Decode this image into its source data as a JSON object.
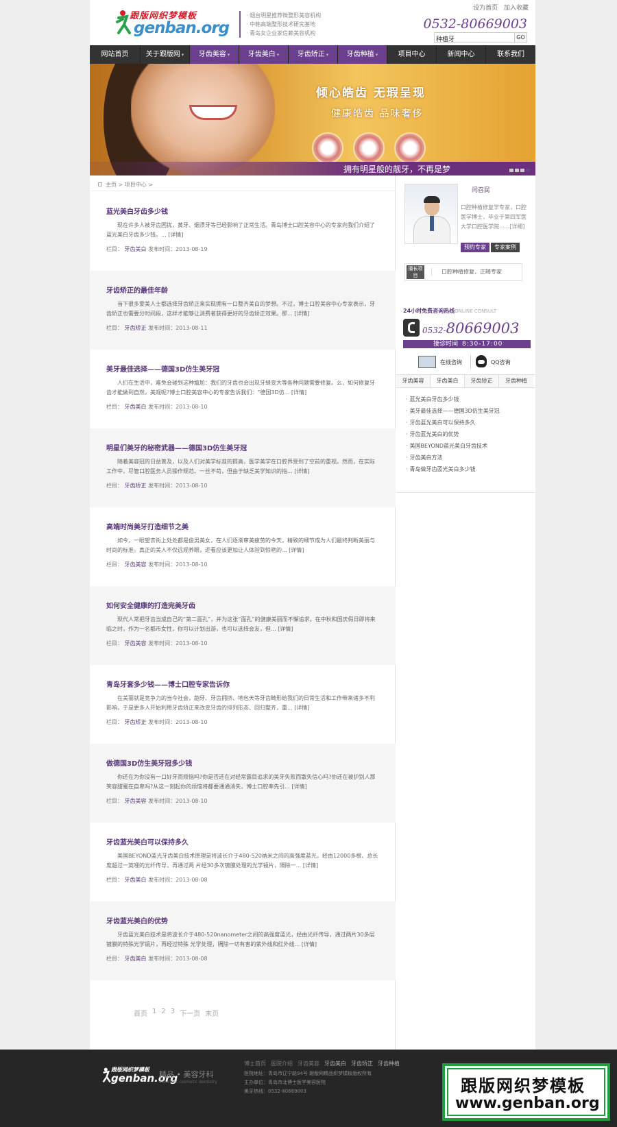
{
  "header": {
    "logo_cn": "跟版网织梦模板",
    "logo_en": "genban.org",
    "slogans": [
      "· 烟台明星推荐微整形美容机构",
      "· 中韩高端整形技术研究基地",
      "· 青岛女企业家信赖美容机构"
    ],
    "top_links": [
      "设为首页",
      "加入收藏"
    ],
    "phone": "0532-80669003",
    "search_value": "种植牙",
    "search_button": "GO"
  },
  "nav": [
    {
      "label": "网站首页",
      "dropdown": false,
      "highlight": false
    },
    {
      "label": "关于跟版网",
      "dropdown": true,
      "highlight": false
    },
    {
      "label": "牙齿美容",
      "dropdown": true,
      "highlight": true
    },
    {
      "label": "牙齿美白",
      "dropdown": true,
      "highlight": true
    },
    {
      "label": "牙齿矫正",
      "dropdown": true,
      "highlight": true
    },
    {
      "label": "牙齿种植",
      "dropdown": true,
      "highlight": true
    },
    {
      "label": "项目中心",
      "dropdown": false,
      "highlight": false
    },
    {
      "label": "新闻中心",
      "dropdown": false,
      "highlight": false
    },
    {
      "label": "联系我们",
      "dropdown": false,
      "highlight": false
    }
  ],
  "banner": {
    "headline": "倾心皓齿 无瑕呈现",
    "sub": "健康皓齿 品味奢侈",
    "bottom": "拥有明星般的靓牙，不再是梦"
  },
  "breadcrumb": {
    "home": "主页",
    "current": "项目中心"
  },
  "articles": [
    {
      "title": "蓝光美白牙齿多少钱",
      "summary": "现在许多人被牙齿困扰，黄牙、烟渍牙等已经影响了正常生活。青岛博士口腔美容中心的专家向我们介绍了蓝光美白牙齿多少钱。...",
      "more": "[详情]",
      "cat_label": "栏目：",
      "cat": "牙齿美白",
      "date_label": "发布时间：",
      "date": "2013-08-19"
    },
    {
      "title": "牙齿矫正的最佳年龄",
      "summary": "当下很多爱美人士都选择牙齿矫正来实现拥有一口整齐美白的梦想。不过，博士口腔美容中心专家表示，牙齿矫正也需要分时间段，这样才能够让消费者获得更好的牙齿矫正效果。那...",
      "more": "[详情]",
      "cat_label": "栏目：",
      "cat": "牙齿矫正",
      "date_label": "发布时间：",
      "date": "2013-08-11"
    },
    {
      "title": "美牙最佳选择——德国3D仿生美牙冠",
      "summary": "人们在生活中，难免会碰到这种尴尬：我们的牙齿也会出现牙缝变大等各种问题需要修复。么，如何修复牙齿才能做到自然，美观呢?博士口腔美容中心的专家告诉我们：“德国3D仿...",
      "more": "[详情]",
      "cat_label": "栏目：",
      "cat": "牙齿美白",
      "date_label": "发布时间：",
      "date": "2013-08-10"
    },
    {
      "title": "明星们美牙的秘密武器——德国3D仿生美牙冠",
      "summary": "随着美容冠的日益普及，以及人们对美学标准的提高，医学美学在口腔界受到了空前的重视。然而，在实际工作中，尽管口腔医务人员操作规范、一丝不苟，但由于缺乏美学知识的指...",
      "more": "[详情]",
      "cat_label": "栏目：",
      "cat": "牙齿矫正",
      "date_label": "发布时间：",
      "date": "2013-08-10"
    },
    {
      "title": "高端时尚美牙打造细节之美",
      "summary": "如今，一眼望去街上处处都是俊男美女，在人们逐渐审美疲劳的今天，精致的细节成为人们最终判断美丽与时尚的标准。真正的美人不仅远观养眼，近看应该更加让人体验到惊艳的...",
      "more": "[详情]",
      "cat_label": "栏目：",
      "cat": "牙齿美容",
      "date_label": "发布时间：",
      "date": "2013-08-10"
    },
    {
      "title": "如何安全健康的打造完美牙齿",
      "summary": "现代人常把牙齿当成自己的“第二面孔”，并为这张“面孔”的健康美丽而不懈追求。在中秋和国庆假日即将来临之时，作为一名都市女性，你可以计划出游，也可以选择会友，但...",
      "more": "[详情]",
      "cat_label": "栏目：",
      "cat": "牙齿美容",
      "date_label": "发布时间：",
      "date": "2013-08-10"
    },
    {
      "title": "青岛牙套多少钱——博士口腔专家告诉你",
      "summary": "在美丽就是竞争力的当今社会，龅牙、牙齿拥挤、地包天等牙齿畸形给我们的日常生活和工作带来诸多不利影响，于是更多人开始利用牙齿矫正来改变牙齿的排列形态、回归整齐，重...",
      "more": "[详情]",
      "cat_label": "栏目：",
      "cat": "牙齿矫正",
      "date_label": "发布时间：",
      "date": "2013-08-10"
    },
    {
      "title": "做德国3D仿生美牙冠多少钱",
      "summary": "你还在为你没有一口好牙而烦恼吗?你是否还在对经常露目追求的美牙失败而散失信心吗?你还在被护别人那笑容甜蜜在自卑吗?从这一刻起你的烦恼将都要通通消失，博士口腔率先引...",
      "more": "[详情]",
      "cat_label": "栏目：",
      "cat": "牙齿美容",
      "date_label": "发布时间：",
      "date": "2013-08-10"
    },
    {
      "title": "牙齿蓝光美白可以保持多久",
      "summary": "美国BEYOND蓝光牙齿美白技术原理是将波长介于480-520纳米之间的高强度蓝光，经由12000多根、总长度超过一英哩的光纤传导，再通过两 片经30多次镀膜处理的光学镜片，隔除一...",
      "more": "[详情]",
      "cat_label": "栏目：",
      "cat": "牙齿美白",
      "date_label": "发布时间：",
      "date": "2013-08-08"
    },
    {
      "title": "牙齿蓝光美白的优势",
      "summary": "牙齿蓝光美白技术是将波长介于480-520nanometer之间的高强度蓝光，经由光纤传导，通过两片30多层镀膜的特殊光学镜片，再经过特殊 光学处理，隔除一切有害的紫外线和红外线...",
      "more": "[详情]",
      "cat_label": "栏目：",
      "cat": "牙齿美白",
      "date_label": "发布时间：",
      "date": "2013-08-08"
    }
  ],
  "pager": [
    "首页",
    "1",
    "2",
    "3",
    "下一页",
    "末页"
  ],
  "doctor": {
    "name": "闫召民",
    "desc": "口腔种植修复学专家，口腔医学博士，毕业于第四军医大学口腔医学院......[详细]",
    "btn_reserve": "预约专家",
    "btn_cases": "专家案例",
    "spec_label": "擅长项目",
    "spec": "口腔种植修复、正畸专家"
  },
  "hotline": {
    "label": "24小时免费咨询热线",
    "label_en": "ONLINE CONSULT",
    "prefix": "0532-",
    "number": "80669003",
    "hours_label": "接诊时间",
    "hours": "8:30-17:00",
    "online": "在线咨询",
    "qq": "QQ咨询"
  },
  "side_tabs": [
    {
      "label": "牙齿美容",
      "active": false
    },
    {
      "label": "牙齿美白",
      "active": true
    },
    {
      "label": "牙齿矫正",
      "active": false
    },
    {
      "label": "牙齿种植",
      "active": false
    }
  ],
  "side_links": [
    "蓝光美白牙齿多少钱",
    "美牙最佳选择——德国3D仿生美牙冠",
    "牙齿蓝光美白可以保持多久",
    "牙齿蓝光美白的优势",
    "美国BEYOND蓝光美白牙齿技术",
    "牙齿美白方法",
    "青岛做牙齿蓝光美白多少钱"
  ],
  "footer": {
    "logo_cn": "跟版网织梦模板",
    "logo_en": "genban.org",
    "tag": "精品 • 美容牙科",
    "tag_en": "excellent cosmetic dentistry",
    "nav": [
      "博士首页",
      "医院介绍",
      "牙齿美容",
      "牙齿美白",
      "牙齿矫正",
      "牙齿种植"
    ],
    "address": "医院地址：青岛市辽宁路94号 跟版网精品织梦模板版权所有",
    "host": "主办单位：青岛市北博士医学美容医院",
    "tel": "美牙热线：0532-80669003"
  },
  "watermark": {
    "line1": "跟版网织梦模板",
    "line2": "www.genban.org"
  }
}
